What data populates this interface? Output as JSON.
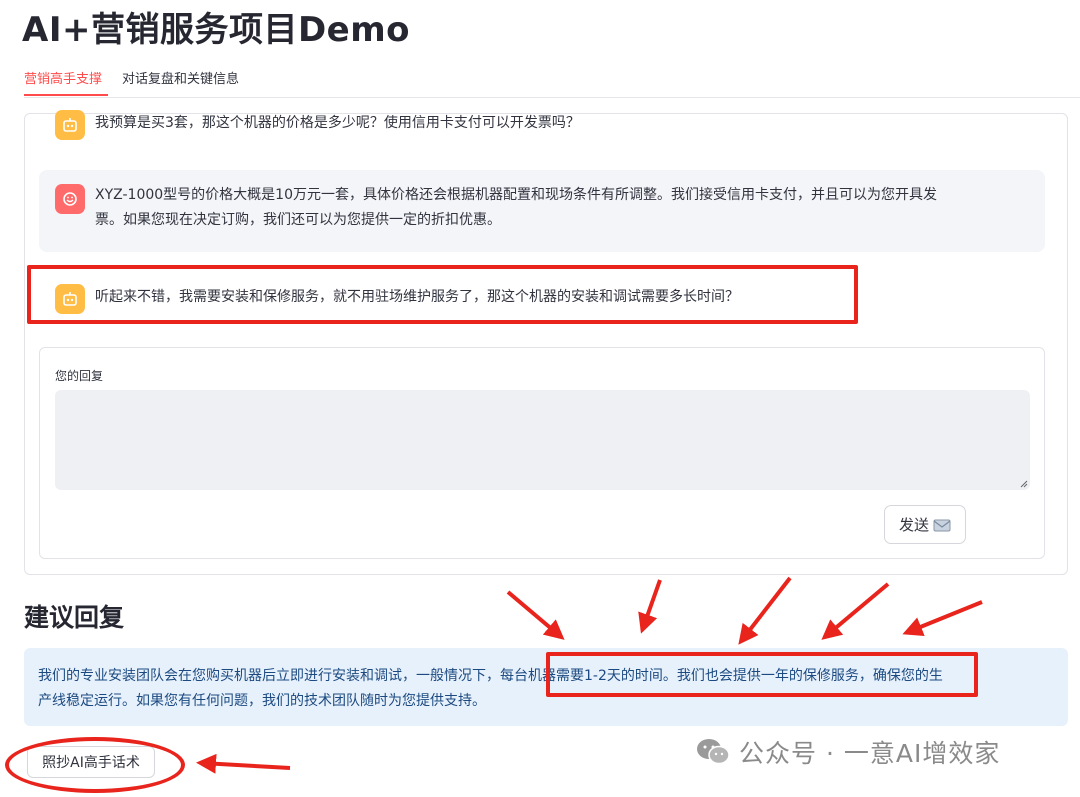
{
  "page": {
    "title": "AI+营销服务项目Demo"
  },
  "tabs": [
    {
      "label": "营销高手支撑",
      "active": true
    },
    {
      "label": "对话复盘和关键信息",
      "active": false
    }
  ],
  "chat": {
    "messages": [
      {
        "role": "user",
        "icon": "robot-face-icon",
        "text": "我预算是买3套，那这个机器的价格是多少呢？使用信用卡支付可以开发票吗？"
      },
      {
        "role": "assistant",
        "icon": "smile-face-icon",
        "line1": "XYZ-1000型号的价格大概是10万元一套，具体价格还会根据机器配置和现场条件有所调整。我们接受信用卡支付，并且可以为您开具发",
        "line2": "票。如果您现在决定订购，我们还可以为您提供一定的折扣优惠。"
      },
      {
        "role": "user",
        "icon": "robot-face-icon",
        "text": "听起来不错，我需要安装和保修服务，就不用驻场维护服务了，那这个机器的安装和调试需要多长时间？"
      }
    ]
  },
  "reply": {
    "label": "您的回复",
    "value": "",
    "send_label": "发送",
    "send_icon": "envelope-icon"
  },
  "suggestion": {
    "title": "建议回复",
    "line1": "我们的专业安装团队会在您购买机器后立即进行安装和调试，一般情况下，每台机器需要1-2天的时间。我们也会提供一年的保修服务，确保您的生",
    "line2": "产线稳定运行。如果您有任何问题，我们的技术团队随时为您提供支持。",
    "copy_label": "照抄AI高手话术"
  },
  "watermark": {
    "icon": "wechat-icon",
    "text": "公众号 · 一意AI增效家"
  },
  "colors": {
    "accent": "#ff4b4b",
    "annotation": "#e8241c",
    "user_avatar": "#ffbd45",
    "bot_avatar": "#ff6b6b",
    "suggest_bg": "#e7f1fc",
    "suggest_text": "#1c4a80"
  }
}
